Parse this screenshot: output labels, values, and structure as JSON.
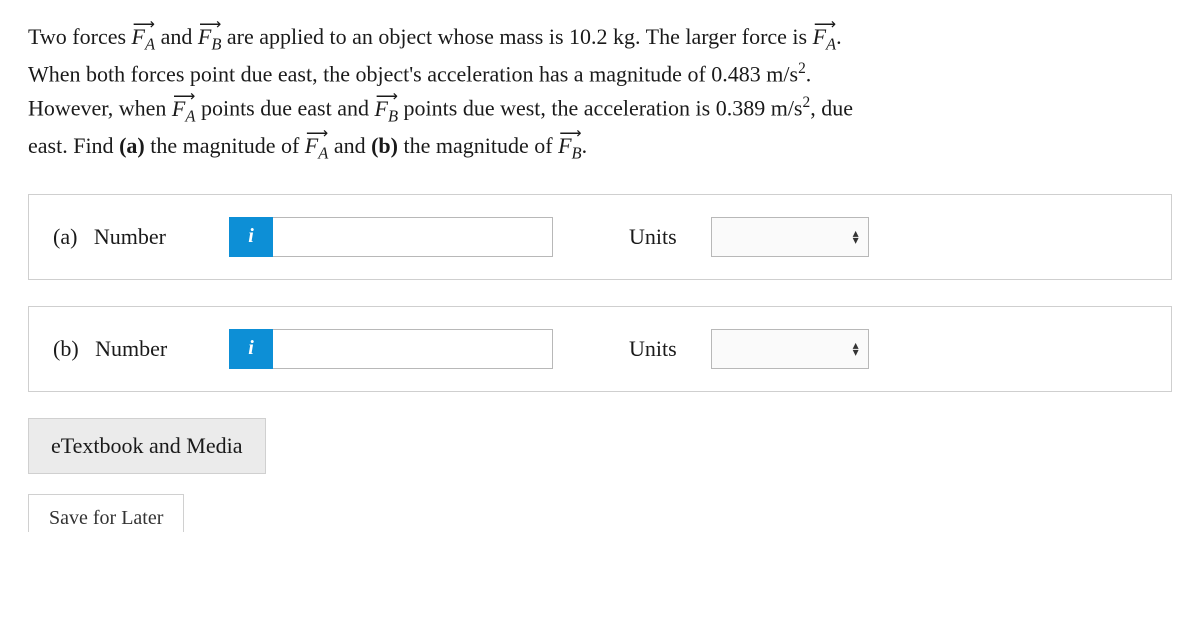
{
  "problem": {
    "line1_prefix": "Two forces ",
    "fa": "F",
    "fa_sub": "A",
    "and1": " and ",
    "fb": "F",
    "fb_sub": "B",
    "line1_mid1": " are applied to an object whose mass is 10.2 kg. The larger force is ",
    "line1_period": ".",
    "line2": "When both forces point due east, the object's acceleration has a magnitude of 0.483 m/s",
    "sq1": "2",
    "line2_end": ".",
    "line3_prefix": "However, when ",
    "line3_mid1": " points due east and ",
    "line3_mid2": " points due west, the acceleration is 0.389 m/s",
    "line3_end": ", due",
    "line4_prefix": "east. Find ",
    "part_a_bold": "(a)",
    "line4_mid1": " the magnitude of ",
    "and2": " and ",
    "part_b_bold": "(b)",
    "line4_mid2": " the magnitude of ",
    "line4_end": "."
  },
  "answers": {
    "a": {
      "label_part": "(a)",
      "label_text": "Number",
      "info_icon": "i",
      "units_label": "Units",
      "input_value": "",
      "units_value": ""
    },
    "b": {
      "label_part": "(b)",
      "label_text": "Number",
      "info_icon": "i",
      "units_label": "Units",
      "input_value": "",
      "units_value": ""
    }
  },
  "buttons": {
    "etextbook": "eTextbook and Media",
    "save": "Save for Later"
  }
}
